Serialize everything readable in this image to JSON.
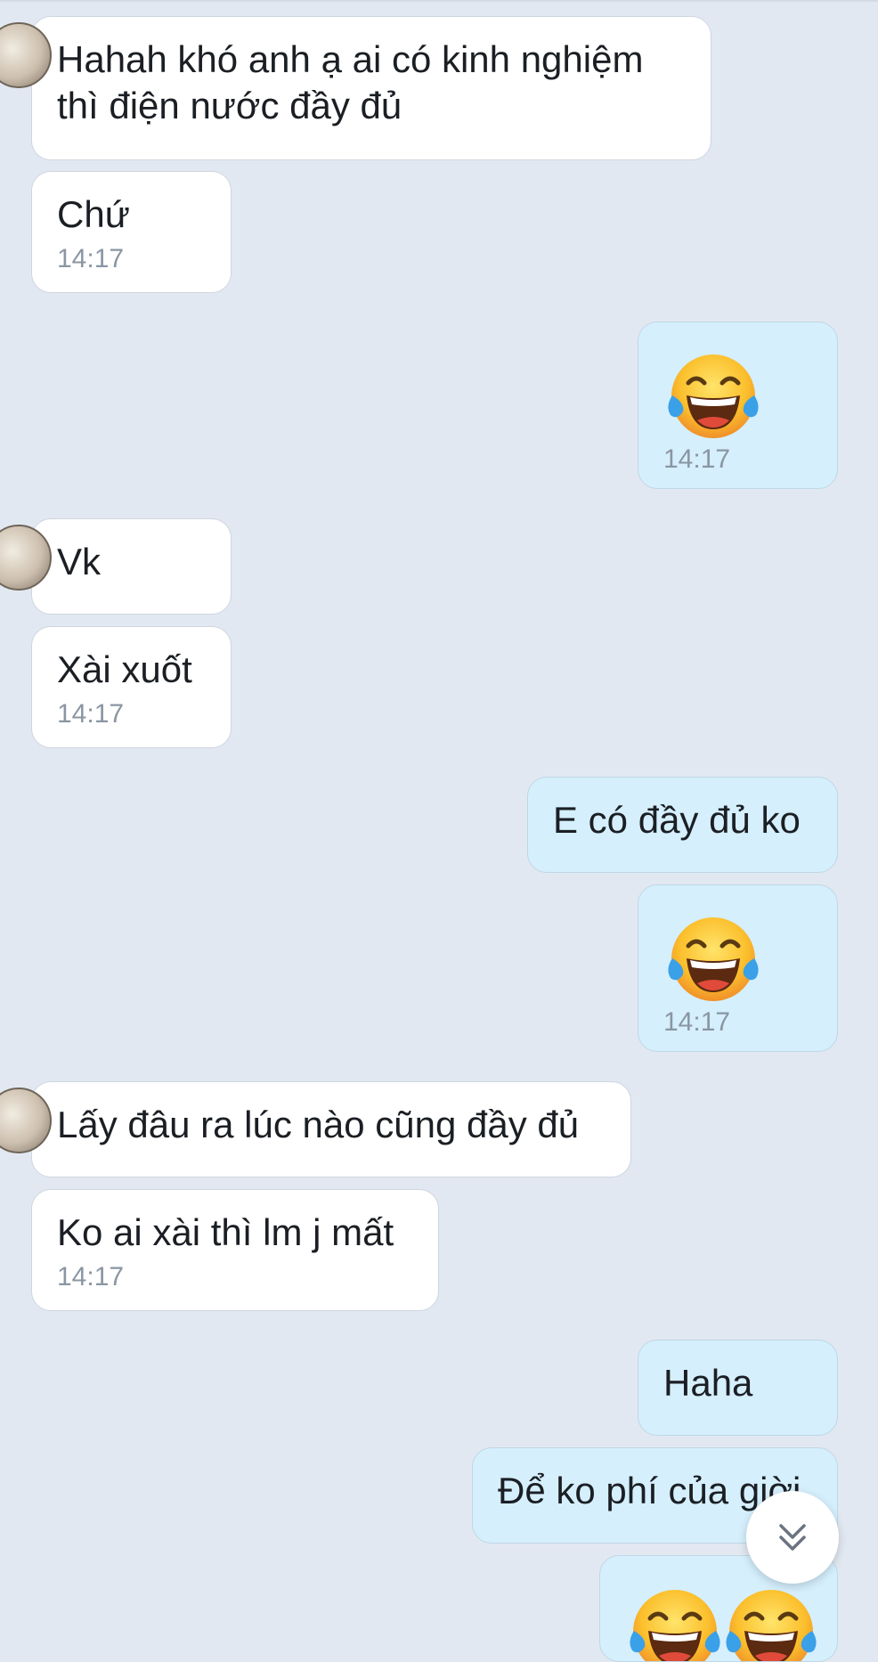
{
  "messages": [
    {
      "side": "in",
      "text": "Hahah khó anh ạ ai có kinh nghiệm thì điện nước đầy đủ"
    },
    {
      "side": "in",
      "text": "Chứ",
      "time": "14:17"
    },
    {
      "side": "out",
      "emoji": "face-with-tears-of-joy-emoji",
      "time": "14:17"
    },
    {
      "side": "in",
      "text": "Vk"
    },
    {
      "side": "in",
      "text": "Xài xuốt",
      "time": "14:17"
    },
    {
      "side": "out",
      "text": "E có đầy đủ ko"
    },
    {
      "side": "out",
      "emoji": "face-with-tears-of-joy-emoji",
      "time": "14:17"
    },
    {
      "side": "in",
      "text": "Lấy đâu ra lúc nào cũng đầy đủ"
    },
    {
      "side": "in",
      "text": "Ko ai xài thì lm j mất",
      "time": "14:17"
    },
    {
      "side": "out",
      "text": "Haha"
    },
    {
      "side": "out",
      "text": "Để ko phí của giời"
    },
    {
      "side": "out",
      "emoji": "face-with-tears-of-joy-emoji"
    }
  ],
  "scroll_button": {
    "icon": "double-chevron-down-icon"
  },
  "colors": {
    "background": "#e2e8f1",
    "incoming_bubble": "#ffffff",
    "outgoing_bubble": "#d5effd",
    "time_text": "#8b96a2"
  }
}
